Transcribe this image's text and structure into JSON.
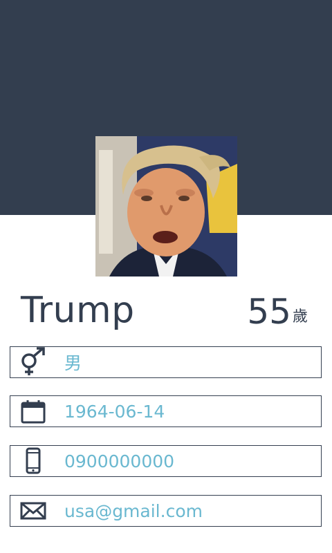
{
  "profile": {
    "name": "Trump",
    "age_number": "55",
    "age_unit": "歲"
  },
  "fields": {
    "gender": {
      "icon": "gender-icon",
      "value": "男"
    },
    "birthday": {
      "icon": "calendar-icon",
      "value": "1964-06-14"
    },
    "phone": {
      "icon": "mobile-phone-icon",
      "value": "0900000000"
    },
    "email": {
      "icon": "envelope-icon",
      "value": "usa@gmail.com"
    }
  },
  "colors": {
    "header": "#333e4f",
    "text_dark": "#333e4f",
    "value_text": "#6ab8d0",
    "border": "#333e4f"
  }
}
